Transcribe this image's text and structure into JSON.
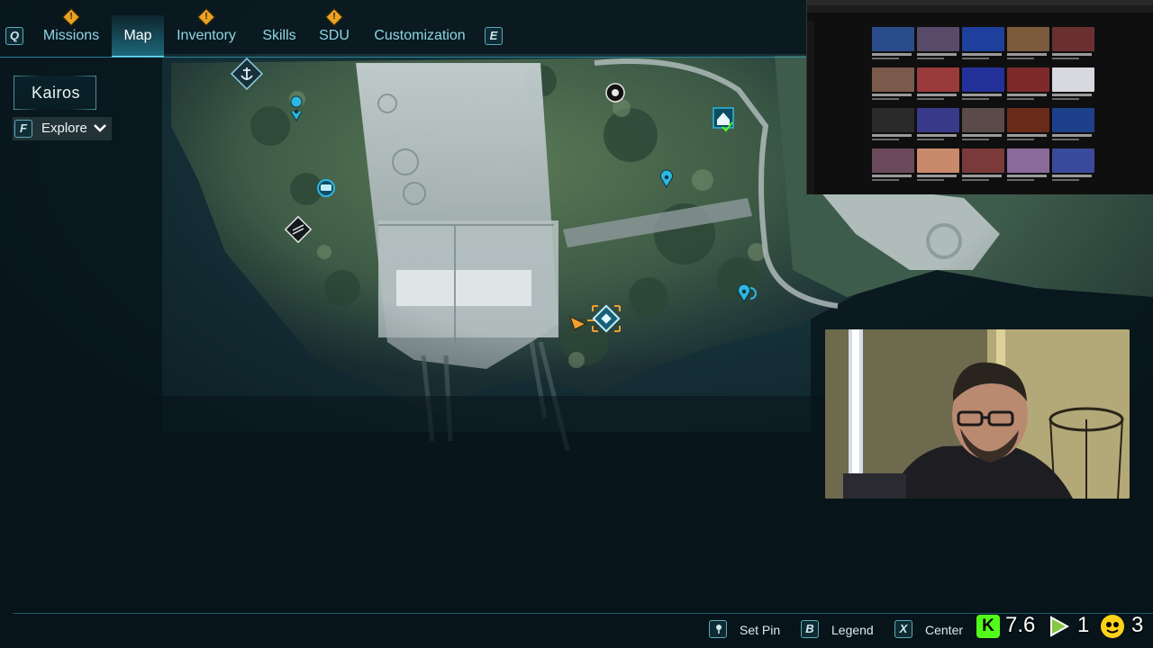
{
  "nav": {
    "left_key": "Q",
    "right_key": "E",
    "tabs": [
      {
        "label": "Missions",
        "alert": true
      },
      {
        "label": "Map",
        "active": true
      },
      {
        "label": "Inventory",
        "alert": true
      },
      {
        "label": "Skills"
      },
      {
        "label": "SDU",
        "alert": true
      },
      {
        "label": "Customization"
      }
    ],
    "alert_glyph": "!"
  },
  "region": {
    "name": "Kairos"
  },
  "explore": {
    "key": "F",
    "label": "Explore",
    "icon": "chevron-down-icon"
  },
  "hints": [
    {
      "key": "",
      "label": "Set Pin",
      "icon": "right-stick-icon"
    },
    {
      "key": "B",
      "label": "Legend"
    },
    {
      "key": "X",
      "label": "Center"
    }
  ],
  "map_markers": [
    "anchor-icon",
    "map-pin-icon",
    "vehicle-icon",
    "beacon-icon",
    "camera-drone-icon",
    "house-icon",
    "map-pin-icon",
    "map-pin-icon",
    "player-cursor-icon",
    "objective-diamond-icon"
  ],
  "stream_stats": {
    "kick_glyph": "K",
    "kick_viewers": "7.6",
    "rumble_viewers": "1",
    "other_viewers": "3"
  },
  "colors": {
    "accent": "#6fe0f5",
    "alert": "#e8a325",
    "objective": "#f0a030",
    "marker": "#2fb6e0",
    "kick_green": "#53fc18"
  }
}
